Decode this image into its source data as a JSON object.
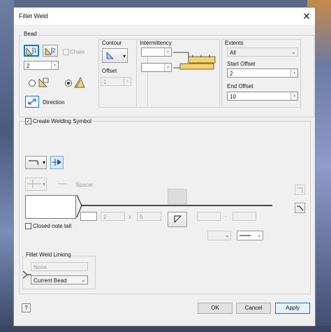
{
  "window": {
    "title": "Fillet Weld",
    "close_glyph": "✕"
  },
  "bead": {
    "label": "Bead",
    "side1_label": "1",
    "side2_label": "2",
    "chain_label": "Chain",
    "count_value": "2",
    "direction_label": "Direction"
  },
  "contour": {
    "label": "Contour",
    "offset_label": "Offset",
    "offset_value": "1"
  },
  "intermittency": {
    "label": "Intermittency",
    "value1": "",
    "value2": ""
  },
  "extents": {
    "label": "Extents",
    "type_value": "All",
    "start_offset_label": "Start Offset",
    "start_offset_value": "2",
    "end_offset_label": "End Offset",
    "end_offset_value": "10"
  },
  "symbol": {
    "create_label": "Create Welding Symbol",
    "spacer_label": "Spacer",
    "closed_note_tail_label": "Closed note tail",
    "size_value": "",
    "length_value": "2",
    "times_glyph": "x",
    "pitch_value": "5",
    "dash_glyph": "-"
  },
  "linking": {
    "label": "Fillet Weld Linking",
    "none_value": "None",
    "current_value": "Current Bead"
  },
  "footer": {
    "help_glyph": "?",
    "ok_label": "OK",
    "cancel_label": "Cancel",
    "apply_label": "Apply"
  }
}
